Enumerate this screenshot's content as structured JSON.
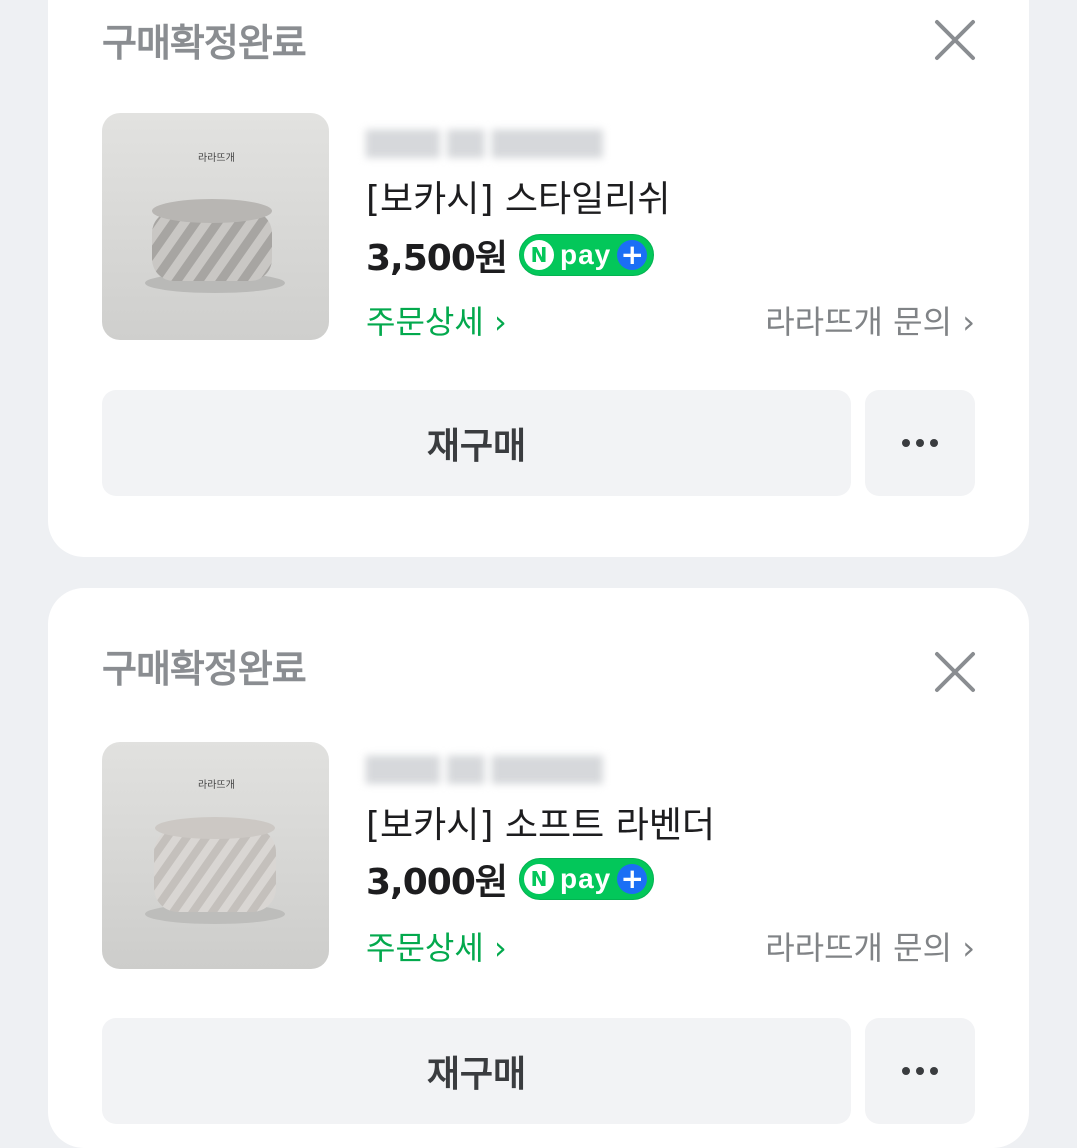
{
  "orders": [
    {
      "status": "구매확정완료",
      "product_name": "[보카시] 스타일리쉬",
      "price": "3,500원",
      "pay_badge": {
        "n": "N",
        "label": "pay",
        "plus": "+"
      },
      "detail_link": "주문상세",
      "inquiry_link": "라라뜨개 문의",
      "rebuy_label": "재구매",
      "thumb_label": "라라뜨개",
      "yarn_color": "#9c9a97"
    },
    {
      "status": "구매확정완료",
      "product_name": "[보카시] 소프트 라벤더",
      "price": "3,000원",
      "pay_badge": {
        "n": "N",
        "label": "pay",
        "plus": "+"
      },
      "detail_link": "주문상세",
      "inquiry_link": "라라뜨개 문의",
      "rebuy_label": "재구매",
      "thumb_label": "라라뜨개",
      "yarn_color": "#bdb9b5"
    }
  ],
  "colors": {
    "accent_green": "#03c75a",
    "link_green": "#03a94d",
    "npay_plus_blue": "#1b6ff5"
  }
}
